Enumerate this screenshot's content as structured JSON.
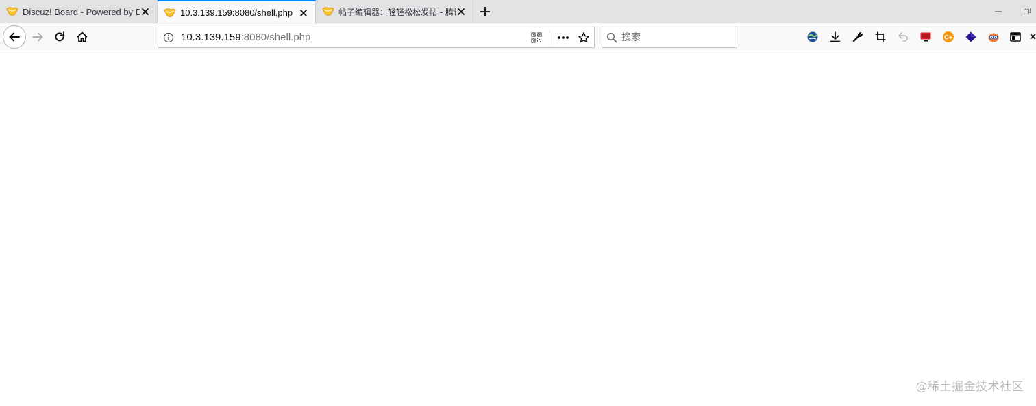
{
  "tabs": [
    {
      "title": "Discuz! Board - Powered by Discuz!",
      "favicon": "discuz-favicon-icon",
      "active": false
    },
    {
      "title": "10.3.139.159:8080/shell.php",
      "favicon": "discuz-favicon-icon",
      "active": true
    },
    {
      "title": "帖子编辑器：轻轻松松发帖 - 腾讯",
      "favicon": "discuz-favicon-icon",
      "active": false
    }
  ],
  "new_tab_icon": "plus-icon",
  "urlbar": {
    "host": "10.3.139.159",
    "port_path": ":8080/shell.php"
  },
  "search": {
    "placeholder": "搜索",
    "value": ""
  },
  "toolbar_icons": [
    "globe-addon-icon",
    "download-icon",
    "wrench-icon",
    "crop-icon",
    "undo-icon",
    "monitor-addon-icon",
    "coin-addon-icon",
    "diamond-addon-icon",
    "owl-addon-icon",
    "sidebar-icon",
    "overflow-icon"
  ],
  "watermark": "@稀土掘金技术社区",
  "colors": {
    "active_tab_accent": "#0a84ff",
    "tabstrip_bg": "#e3e3e6",
    "toolbar_bg": "#f9f9fa",
    "content_bg": "#ffffff"
  }
}
